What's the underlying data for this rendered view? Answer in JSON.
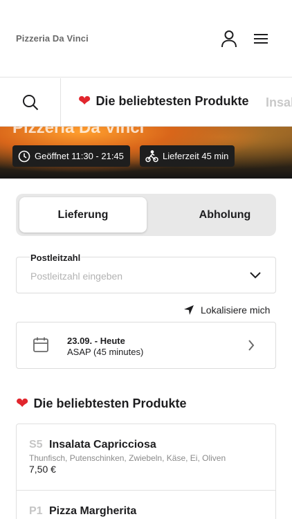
{
  "header": {
    "brand": "Pizzeria Da Vinci",
    "icons": {
      "user": "user-icon",
      "menu": "hamburger-menu-icon"
    }
  },
  "category_bar": {
    "search_icon": "search-icon",
    "active_category": "Die beliebtesten Produkte",
    "active_category_icon": "heart-icon",
    "next_category": "Insal"
  },
  "hero": {
    "title": "Pizzeria Da Vinci",
    "opening_hours": "Geöffnet 11:30 - 21:45",
    "delivery_time": "Lieferzeit 45 min"
  },
  "order_mode": {
    "options": [
      "Lieferung",
      "Abholung"
    ],
    "selected": "Lieferung"
  },
  "zip": {
    "label": "Postleitzahl",
    "placeholder": "Postleitzahl eingeben",
    "value": ""
  },
  "locate_label": "Lokalisiere mich",
  "schedule": {
    "date": "23.09. - Heute",
    "time": "ASAP (45 minutes)"
  },
  "section": {
    "title": "Die beliebtesten Produkte"
  },
  "products": [
    {
      "code": "S5",
      "name": "Insalata Capricciosa",
      "description": "Thunfisch, Putenschinken, Zwiebeln, Käse, Ei, Oliven",
      "price": "7,50 €"
    },
    {
      "code": "P1",
      "name": "Pizza Margherita",
      "description": "",
      "price": ""
    }
  ],
  "colors": {
    "accent_heart": "#e1262d",
    "text": "#1d1d1f",
    "muted": "#8a8a8a",
    "border": "#dcdcdc",
    "toggle_bg": "#e8e8e8"
  }
}
